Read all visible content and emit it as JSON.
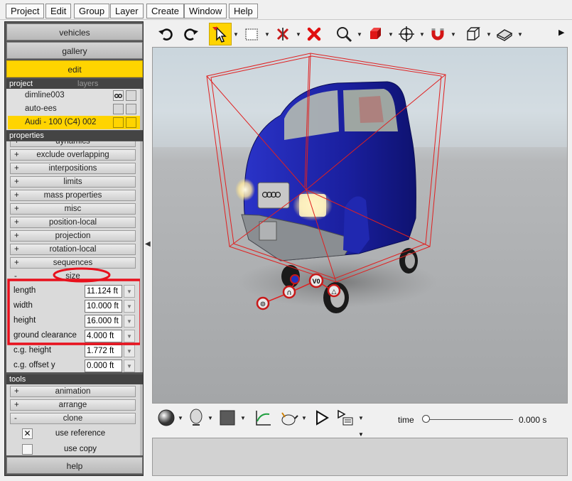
{
  "menu": [
    "Project",
    "Edit",
    "Group",
    "Layer",
    "Create",
    "Window",
    "Help"
  ],
  "left_panel": {
    "tabs": [
      "vehicles",
      "gallery",
      "edit"
    ],
    "active_tab": "edit",
    "project_header": "project",
    "layers_header": "layers",
    "project_items": [
      "dimline003",
      "auto-ees",
      "Audi - 100 (C4) 002"
    ],
    "selected_item": "Audi - 100 (C4) 002",
    "properties_header": "properties",
    "property_groups": [
      {
        "sign": "+",
        "label": "dynamics"
      },
      {
        "sign": "+",
        "label": "exclude overlapping"
      },
      {
        "sign": "+",
        "label": "interpositions"
      },
      {
        "sign": "+",
        "label": "limits"
      },
      {
        "sign": "+",
        "label": "mass properties"
      },
      {
        "sign": "+",
        "label": "misc"
      },
      {
        "sign": "+",
        "label": "position-local"
      },
      {
        "sign": "+",
        "label": "projection"
      },
      {
        "sign": "+",
        "label": "rotation-local"
      },
      {
        "sign": "+",
        "label": "sequences"
      },
      {
        "sign": "-",
        "label": "size"
      }
    ],
    "size_fields": [
      {
        "label": "length",
        "value": "11.124 ft"
      },
      {
        "label": "width",
        "value": "10.000 ft"
      },
      {
        "label": "height",
        "value": "16.000 ft"
      },
      {
        "label": "ground clearance",
        "value": "4.000 ft"
      },
      {
        "label": "c.g. height",
        "value": "1.772 ft"
      },
      {
        "label": "c.g. offset y",
        "value": "0.000 ft"
      }
    ],
    "tools_header": "tools",
    "tool_groups": [
      {
        "sign": "+",
        "label": "animation"
      },
      {
        "sign": "+",
        "label": "arrange"
      },
      {
        "sign": "-",
        "label": "clone"
      }
    ],
    "tool_options": [
      {
        "label": "use reference",
        "checked": true
      },
      {
        "label": "use copy",
        "checked": false
      }
    ],
    "help_label": "help"
  },
  "toolbar_icons": [
    "undo-icon",
    "redo-icon",
    "select-arrow-icon",
    "selection-box-icon",
    "delete-nodes-icon",
    "delete-icon",
    "zoom-icon",
    "solid-cube-icon",
    "move-icon",
    "magnet-icon",
    "wireframe-cube-icon",
    "ground-plane-icon",
    "more-icon"
  ],
  "viewport_handles": [
    "V0",
    "∩",
    "△",
    "⊚",
    "●"
  ],
  "timeline": {
    "time_label": "time",
    "time_value": "0.000 s"
  },
  "colors": {
    "accent_yellow": "#ffd400",
    "car_blue": "#1a1f9e",
    "highlight_red": "#e8101c",
    "wire_red": "#e02020"
  }
}
